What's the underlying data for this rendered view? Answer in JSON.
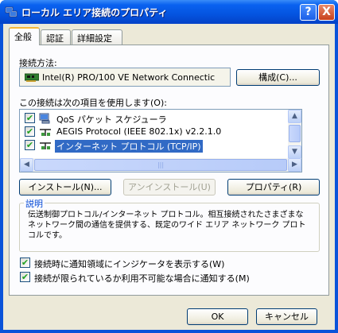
{
  "window": {
    "title": "ローカル エリア接続のプロパティ",
    "help_label": "?",
    "close_label": "X"
  },
  "tabs": [
    {
      "label": "全般",
      "active": true
    },
    {
      "label": "認証",
      "active": false
    },
    {
      "label": "詳細設定",
      "active": false
    }
  ],
  "connection": {
    "label": "接続方法:",
    "device": "Intel(R) PRO/100 VE Network Connectic",
    "configure_label": "構成(C)..."
  },
  "components": {
    "label": "この接続は次の項目を使用します(O):",
    "items": [
      {
        "label": "QoS パケット スケジューラ",
        "checked": true,
        "selected": false,
        "icon": "qos-icon"
      },
      {
        "label": "AEGIS Protocol (IEEE 802.1x) v2.2.1.0",
        "checked": true,
        "selected": false,
        "icon": "protocol-icon"
      },
      {
        "label": "インターネット プロトコル (TCP/IP)",
        "checked": true,
        "selected": true,
        "icon": "protocol-icon"
      }
    ]
  },
  "buttons": {
    "install": "インストール(N)...",
    "uninstall": "アンインストール(U)",
    "properties": "プロパティ(R)",
    "ok": "OK",
    "cancel": "キャンセル"
  },
  "description": {
    "title": "説明",
    "text": "伝送制御プロトコル/インターネット プロトコル。相互接続されたさまざまなネットワーク間の通信を提供する、既定のワイド エリア ネットワーク プロトコルです。"
  },
  "options": [
    {
      "label": "接続時に通知領域にインジケータを表示する(W)",
      "checked": true
    },
    {
      "label": "接続が限られているか利用不可能な場合に通知する(M)",
      "checked": true
    }
  ],
  "colors": {
    "titlebar": "#0454e0",
    "selection": "#316ac5",
    "dialog_bg": "#ece9d8"
  }
}
